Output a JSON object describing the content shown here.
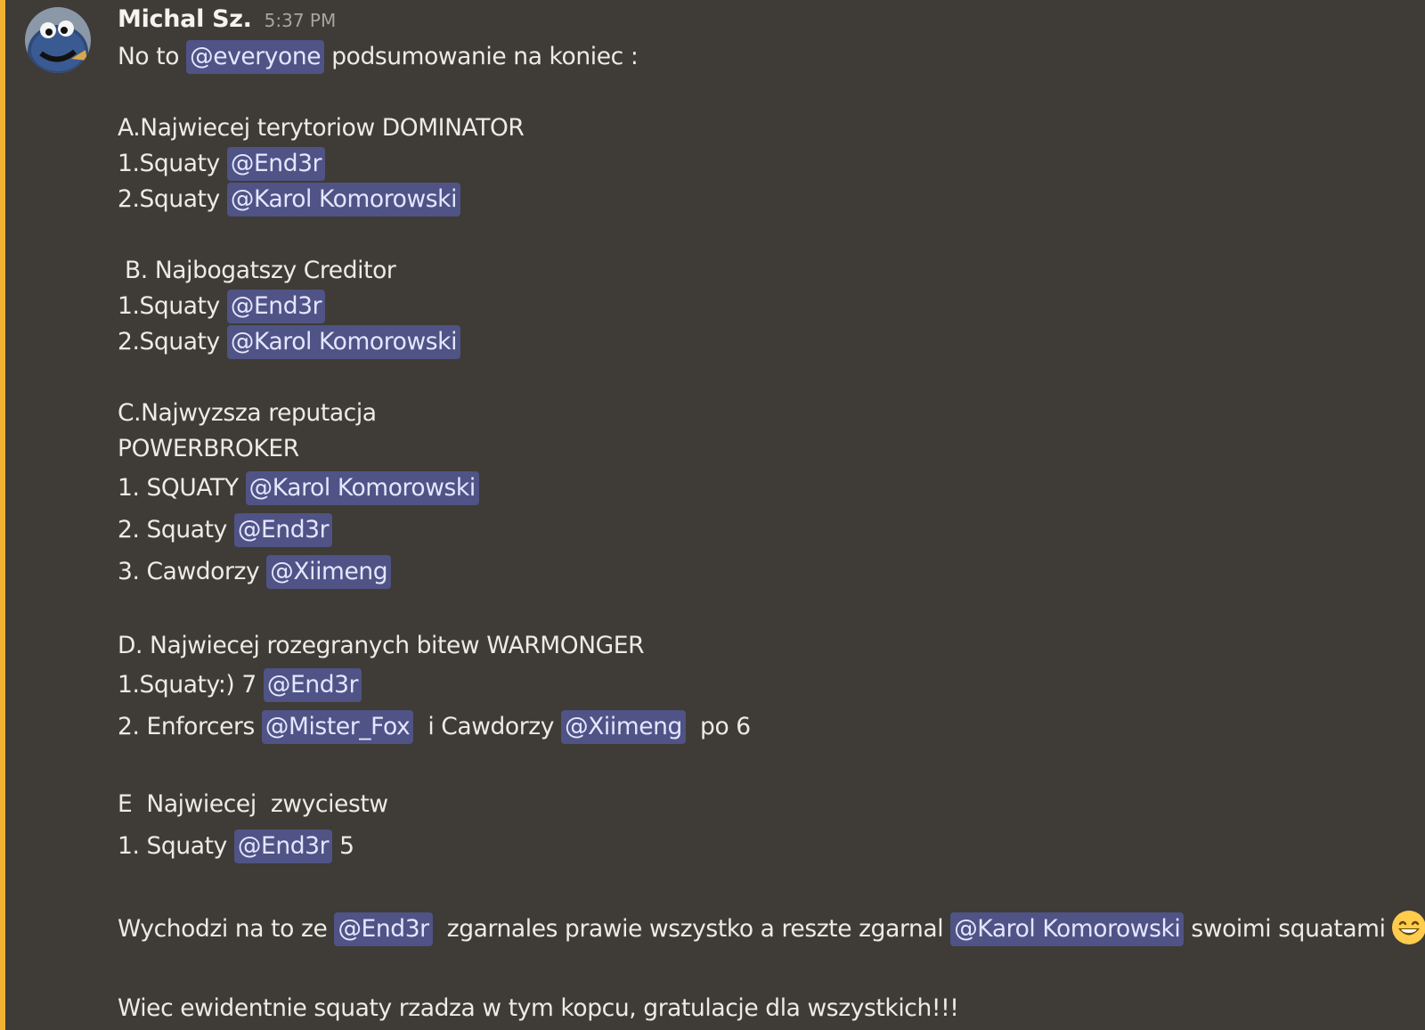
{
  "message": {
    "author": "Michal Sz.",
    "timestamp": "5:37 PM",
    "lines": {
      "l1": {
        "a": "No to ",
        "m1": "@everyone",
        "b": " podsumowanie na koniec :"
      },
      "l2": {
        "a": "A.Najwiecej terytoriow DOMINATOR"
      },
      "l3": {
        "a": "1.Squaty ",
        "m1": "@End3r"
      },
      "l4": {
        "a": "2.Squaty ",
        "m1": "@Karol Komorowski"
      },
      "l5": {
        "a": " B. Najbogatszy Creditor"
      },
      "l6": {
        "a": "1.Squaty ",
        "m1": "@End3r"
      },
      "l7": {
        "a": "2.Squaty ",
        "m1": "@Karol Komorowski"
      },
      "l8": {
        "a": "C.Najwyzsza reputacja"
      },
      "l9": {
        "a": "POWERBROKER"
      },
      "l10": {
        "a": "1. SQUATY ",
        "m1": "@Karol Komorowski"
      },
      "l11": {
        "a": "2. Squaty ",
        "m1": "@End3r"
      },
      "l12": {
        "a": "3. Cawdorzy ",
        "m1": "@Xiimeng"
      },
      "l13": {
        "a": "D. Najwiecej rozegranych bitew WARMONGER"
      },
      "l14": {
        "a": "1.Squaty:) 7 ",
        "m1": "@End3r"
      },
      "l15": {
        "a": "2. Enforcers ",
        "m1": "@Mister_Fox",
        "b": "  i Cawdorzy ",
        "m2": "@Xiimeng",
        "c": "  po 6"
      },
      "l16": {
        "a": "E  Najwiecej  zwyciestw"
      },
      "l17": {
        "a": "1. Squaty ",
        "m1": "@End3r",
        "b": " 5"
      },
      "l18": {
        "a": "Wychodzi na to ze ",
        "m1": "@End3r",
        "b": "  zgarnales prawie wszystko a reszte zgarnal ",
        "m2": "@Karol Komorowski",
        "c": " swoimi squatami",
        "emoji": "grinning-smiling-eyes-emoji"
      },
      "l19": {
        "a": "Wiec ewidentnie squaty rzadza w tym kopcu, gratulacje dla wszystkich!!!"
      }
    }
  },
  "avatar": {
    "icon": "cookie-monster-avatar"
  },
  "colors": {
    "background": "#3f3b36",
    "highlight_bar": "#f0b232",
    "mention_bg": "#4f5385",
    "mention_text": "#e4e6ff",
    "text": "#ecebe8",
    "timestamp": "#a8a49f"
  }
}
